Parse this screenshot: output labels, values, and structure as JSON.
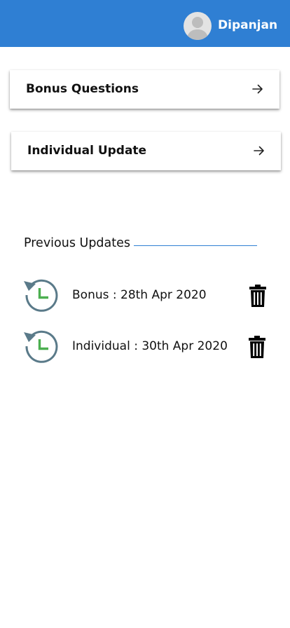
{
  "header": {
    "username": "Dipanjan",
    "avatar_icon": "user-avatar-icon",
    "background": "#2f7fd3"
  },
  "actions": [
    {
      "label": "Bonus Questions",
      "icon": "arrow-right-icon"
    },
    {
      "label": "Individual Update",
      "icon": "arrow-right-icon"
    }
  ],
  "previous_updates": {
    "title": "Previous Updates",
    "items": [
      {
        "text": "Bonus : 28th Apr 2020",
        "icon": "history-icon",
        "action_icon": "trash-icon"
      },
      {
        "text": "Individual : 30th Apr 2020",
        "icon": "history-icon",
        "action_icon": "trash-icon"
      }
    ]
  }
}
